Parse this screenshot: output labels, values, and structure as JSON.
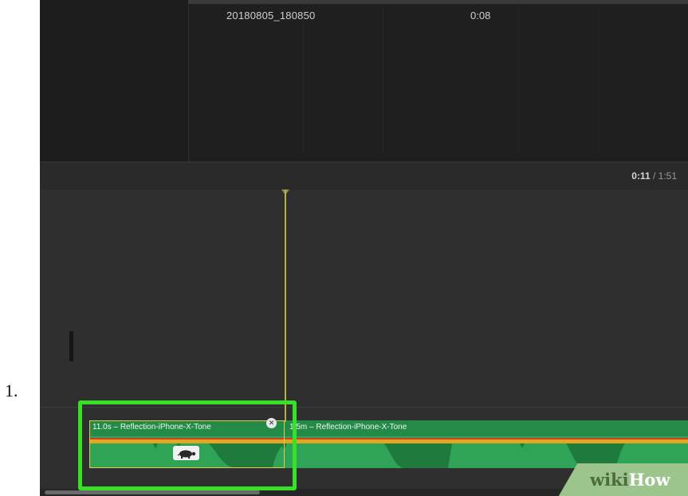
{
  "step": {
    "number": "1."
  },
  "browser": {
    "clip_name": "20180805_180850",
    "clip_duration": "0:08"
  },
  "playback": {
    "current_time": "0:11",
    "separator": " / ",
    "total_time": "1:51"
  },
  "timeline": {
    "audio_clips": [
      {
        "label": "11.0s – Reflection-iPhone-X-Tone",
        "badge_icon": "turtle-icon",
        "selected": true
      },
      {
        "label": "1.5m – Reflection-iPhone-X-Tone"
      }
    ]
  },
  "colors": {
    "highlight": "#38e027",
    "audio_clip": "#2fa457",
    "playhead": "#b7b04a",
    "volume_line": "#e0a81f"
  },
  "watermark": {
    "part1": "wiki",
    "part2": "How"
  }
}
